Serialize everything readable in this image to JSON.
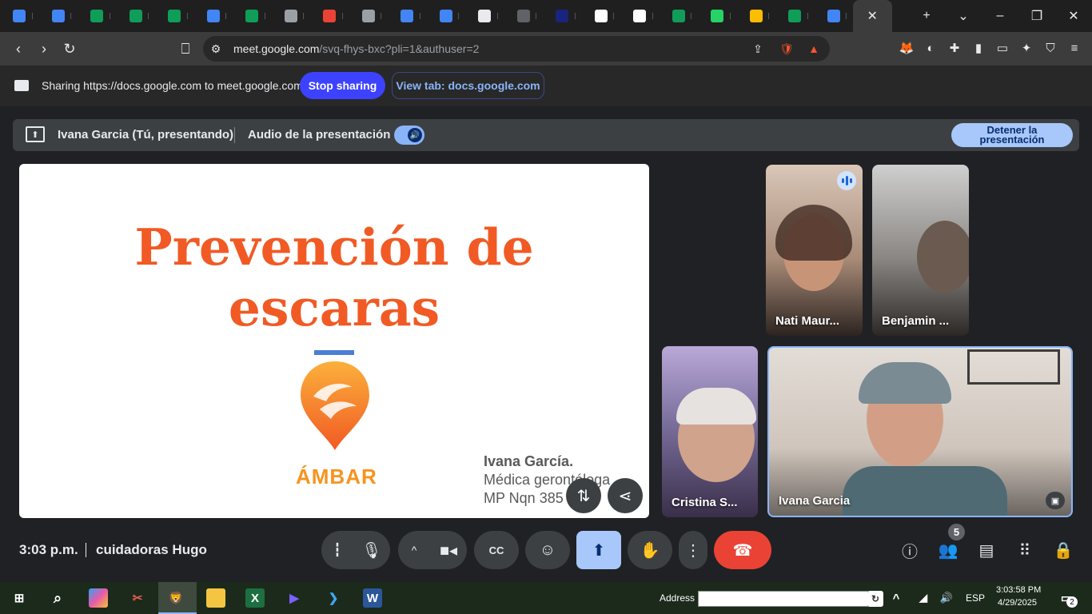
{
  "browser": {
    "tabs": [
      {
        "icon": "docs-icon",
        "color": "#4285f4"
      },
      {
        "icon": "docs-icon",
        "color": "#4285f4"
      },
      {
        "icon": "sheets-icon",
        "color": "#0f9d58"
      },
      {
        "icon": "sheets-icon",
        "color": "#0f9d58"
      },
      {
        "icon": "sheets-icon",
        "color": "#0f9d58"
      },
      {
        "icon": "docs-icon",
        "color": "#4285f4"
      },
      {
        "icon": "sheets-icon",
        "color": "#0f9d58"
      },
      {
        "icon": "globe-icon",
        "color": "#9aa0a6"
      },
      {
        "icon": "gmail-icon",
        "color": "#ea4335"
      },
      {
        "icon": "globe-icon",
        "color": "#9aa0a6"
      },
      {
        "icon": "docs-icon",
        "color": "#4285f4"
      },
      {
        "icon": "docs-icon",
        "color": "#4285f4"
      },
      {
        "icon": "compass-icon",
        "color": "#e8eaed"
      },
      {
        "icon": "script-icon",
        "color": "#5f6368"
      },
      {
        "icon": "shield-icon",
        "color": "#1a237e"
      },
      {
        "icon": "openai-icon",
        "color": "#ffffff"
      },
      {
        "icon": "circle-icon",
        "color": "#ffffff"
      },
      {
        "icon": "sheets-icon",
        "color": "#0f9d58"
      },
      {
        "icon": "whatsapp-icon",
        "color": "#25d366"
      },
      {
        "icon": "drive-icon",
        "color": "#fbbc04"
      },
      {
        "icon": "drive-icon",
        "color": "#0f9d58"
      },
      {
        "icon": "meet-icon",
        "color": "#4285f4"
      }
    ],
    "url_host": "meet.google.com",
    "url_path": "/svq-fhys-bxc?pli=1&authuser=2"
  },
  "share_bar": {
    "text": "Sharing https://docs.google.com to meet.google.com",
    "stop_label": "Stop sharing",
    "view_label": "View tab: docs.google.com"
  },
  "presenting_bar": {
    "presenter": "Ivana Garcia (Tú, presentando)",
    "audio_label": "Audio de la presentación",
    "stop_label_line1": "Detener la",
    "stop_label_line2": "presentación"
  },
  "slide": {
    "title_line1": "Prevención de",
    "title_line2": "escaras",
    "brand": "ÁMBAR",
    "author_name": "Ivana García.",
    "author_role": "Médica gerontóloga",
    "author_license": "MP Nqn 385"
  },
  "participants": [
    {
      "name": "Nati Maur..."
    },
    {
      "name": "Benjamin ..."
    },
    {
      "name": "Cristina S..."
    },
    {
      "name": "Ivana Garcia"
    }
  ],
  "meeting": {
    "time": "3:03 p.m.",
    "title": "cuidadoras Hugo",
    "participant_count": "5"
  },
  "taskbar": {
    "address_label": "Address",
    "lang": "ESP",
    "time": "3:03:58 PM",
    "date": "4/29/2025",
    "notif_count": "2"
  },
  "colors": {
    "accent_stop": "#3c42ff",
    "slide_title": "#f15a24",
    "end_call": "#ea4335",
    "present_active": "#a8c7fa"
  }
}
